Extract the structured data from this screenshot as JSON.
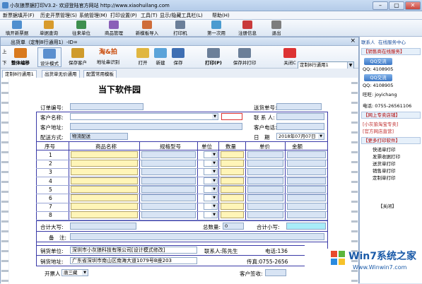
{
  "window": {
    "title": "小灰狼票据打印V3.2- 欢迎登陆官方网站 http://www.xiaohuilang.com",
    "min": "–",
    "max": "▢",
    "close": "✕"
  },
  "menu": [
    "新票据填开(F)",
    "历史开票管理(S)",
    "系统管理(M)",
    "打印设置(P)",
    "工具(T)",
    "显示/隐藏工具栏(L)",
    "帮助(H)"
  ],
  "toolbar": [
    {
      "label": "填开新票据",
      "icon": "new-doc-icon",
      "color": "#4f8fcf"
    },
    {
      "label": "单据查询",
      "icon": "search-icon",
      "color": "#d89b2c"
    },
    {
      "label": "往来单位",
      "icon": "partner-icon",
      "color": "#3e8f4f"
    },
    {
      "label": "商品管理",
      "icon": "product-icon",
      "color": "#8a5fb8"
    },
    {
      "label": "新模板导入",
      "icon": "template-icon",
      "color": "#cf6d3a"
    },
    {
      "label": "打印机",
      "icon": "printer-icon",
      "color": "#6b7f99"
    },
    {
      "label": "第一次用",
      "icon": "first-use-icon",
      "color": "#4a9bd0"
    },
    {
      "label": "注册信息",
      "icon": "register-icon",
      "color": "#c93b3b"
    },
    {
      "label": "退出",
      "icon": "exit-icon",
      "color": "#7d7d7d"
    }
  ],
  "child": {
    "title": "出货单（定制8行通用1）-ID=",
    "close": "×"
  },
  "ctoolbar": [
    {
      "label": "整体编移",
      "icon": "move-icon",
      "color": "#d97a1e"
    },
    {
      "label": "设计模式",
      "icon": "design-icon",
      "color": "#5a8fcf"
    },
    {
      "label": "保存客户",
      "icon": "save-customer-icon",
      "color": "#cf9b2c"
    },
    {
      "label": "地址串识别",
      "icon": "address-icon",
      "color": "#e0a020"
    },
    {
      "label": "打开",
      "icon": "open-icon",
      "color": "#e0b640"
    },
    {
      "label": "新建",
      "icon": "new-icon",
      "color": "#5ba3d9"
    },
    {
      "label": "保存",
      "icon": "save-icon",
      "color": "#3f6fb3"
    },
    {
      "label": "打印(P)",
      "icon": "print-icon",
      "color": "#6b7f99"
    },
    {
      "label": "保存并打印",
      "icon": "save-print-icon",
      "color": "#6b7f99"
    },
    {
      "label": "关闭C",
      "icon": "close-icon",
      "color": "#d33"
    }
  ],
  "ctool_small": {
    "left_label": "上",
    "left_label2": "下",
    "select_value": "定制8行通用1",
    "taobao": "淘&拍"
  },
  "tabs": [
    "定制8行通用1",
    "出货单无价通用",
    "配置常用模板"
  ],
  "form": {
    "title": "当下软件园",
    "order_no_label": "订单编号:",
    "delivery_no_label": "送货单号:",
    "customer_name_label": "客户名称:",
    "contact_label": "联 系 人:",
    "customer_addr_label": "客户地址:",
    "customer_phone_label": "客户电话:",
    "ship_method_label": "配送方式:",
    "ship_method_value": "物流配送",
    "date_label": "日　期",
    "date_value": "2018年07月07日",
    "headers": [
      "序号",
      "商品名称",
      "规格型号",
      "单位",
      "数量",
      "单价",
      "金额"
    ],
    "rows": [
      "1",
      "2",
      "3",
      "4",
      "5",
      "6",
      "7",
      "8"
    ],
    "total_upper_label": "合计大写:",
    "total_qty_label": "总数量:",
    "total_qty_value": "0",
    "subtotal_label": "合计小写:",
    "remark_label": "备　注:",
    "seller_label": "销货单位:",
    "seller_value": "深圳市小灰狼科技有限公司[设计模式修改]",
    "seller_contact": "联系人:陈先生",
    "seller_phone": "电话:136",
    "seller_addr_label": "销货地址:",
    "seller_addr_value": "广东省深圳市南山区南海大道1079号B座203",
    "fax": "传真:0755-2656",
    "issuer_label": "开票人",
    "issuer_value": "唐三藏",
    "sign_label": "客户签收:"
  },
  "sidebar": {
    "header": "联系人",
    "header2": "在线服务中心",
    "sales_title": "【销售商在线服务】",
    "qq_btn": "QQ交流",
    "qq1": "QQ: 4108905",
    "qq2": "QQ: 4108905",
    "wangwang": "旺旺: joyichang",
    "phone": "电话: 0755-26561106",
    "shop_title": "【网上专卖店铺】",
    "shop1": "[小灰狼淘宝专卖]",
    "shop2": "[官方网店直营]",
    "more_title": "【更多打印软件】",
    "more": [
      "快递单打印",
      "发票收据打印",
      "送货单打印",
      "销售单打印",
      "定制单打印"
    ],
    "close": "【关闭】"
  },
  "watermark": {
    "brand": "Win7系统之家",
    "url": "Www.Winwin7.com"
  }
}
